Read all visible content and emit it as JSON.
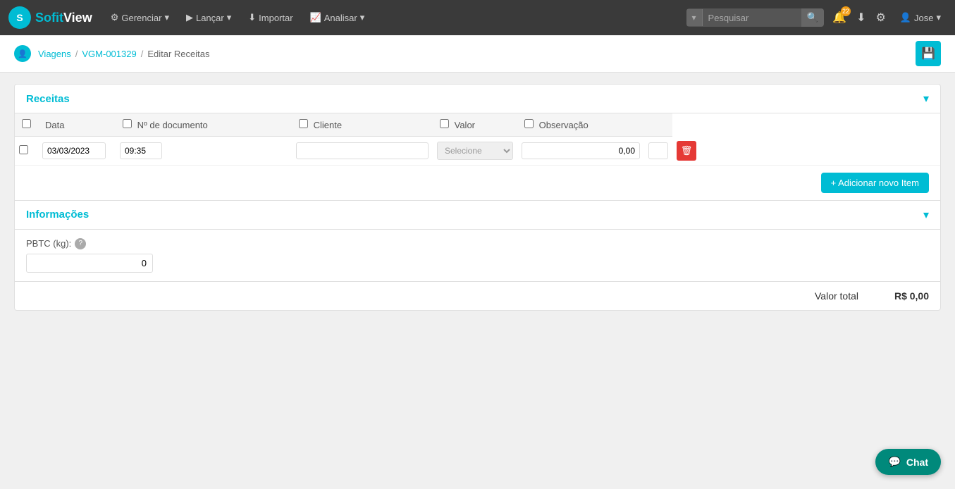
{
  "browser": {
    "url": "sofitview.com.br/#/client/trips/revenues/1329/edit",
    "back_label": "←",
    "forward_label": "→",
    "reload_label": "↺"
  },
  "topnav": {
    "logo_letter": "S",
    "logo_sofit": "Sofit",
    "logo_view": "View",
    "gerenciar_label": "Gerenciar",
    "lancar_label": "Lançar",
    "importar_label": "Importar",
    "analisar_label": "Analisar",
    "search_placeholder": "Pesquisar",
    "notification_count": "22",
    "user_label": "Jose"
  },
  "breadcrumb": {
    "viagens_label": "Viagens",
    "trip_id_label": "VGM-001329",
    "current_label": "Editar Receitas"
  },
  "receitas": {
    "section_title": "Receitas",
    "columns": {
      "data": "Data",
      "doc": "Nº de documento",
      "cliente": "Cliente",
      "valor": "Valor",
      "observacao": "Observação"
    },
    "rows": [
      {
        "data": "03/03/2023",
        "hora": "09:35",
        "documento": "",
        "cliente_placeholder": "Selecione",
        "valor": "0,00",
        "observacao": ""
      }
    ],
    "add_item_label": "+ Adicionar novo Item"
  },
  "informacoes": {
    "section_title": "Informações",
    "pbtc_label": "PBTC (kg):",
    "pbtc_value": "0"
  },
  "total": {
    "label": "Valor total",
    "value": "R$ 0,00"
  },
  "chat": {
    "label": "Chat"
  }
}
